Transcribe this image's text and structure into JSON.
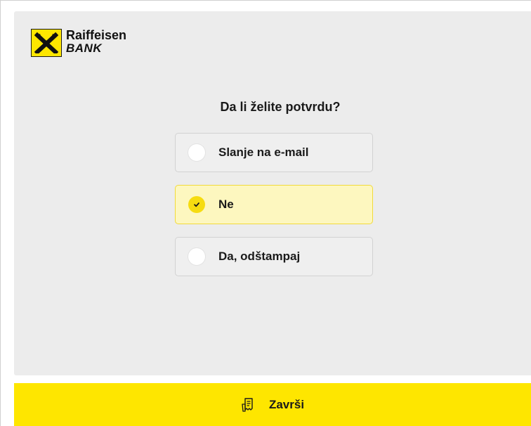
{
  "brand": {
    "name_line1": "Raiffeisen",
    "name_line2": "BANK"
  },
  "question": "Da li želite potvrdu?",
  "options": [
    {
      "label": "Slanje na e-mail",
      "selected": false
    },
    {
      "label": "Ne",
      "selected": true
    },
    {
      "label": "Da, odštampaj",
      "selected": false
    }
  ],
  "footer": {
    "button_label": "Završi",
    "icon": "receipt-icon"
  },
  "colors": {
    "brand_yellow": "#fee600",
    "selected_bg": "#fdf7bf",
    "panel_bg": "#ececec"
  }
}
